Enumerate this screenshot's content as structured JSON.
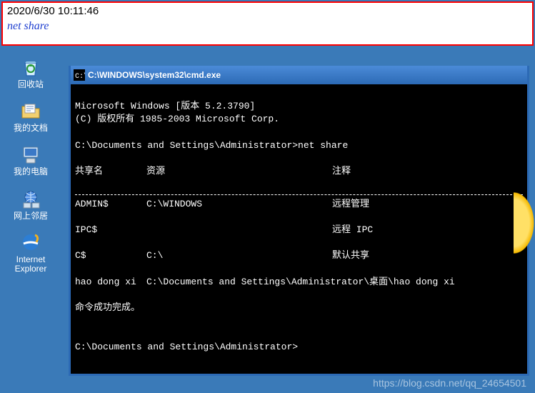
{
  "note": {
    "timestamp": "2020/6/30 10:11:46",
    "command": "net share"
  },
  "desktop": {
    "recycle": "回收站",
    "docs": "我的文档",
    "computer": "我的电脑",
    "network": "网上邻居",
    "ie": "Internet Explorer"
  },
  "cmd": {
    "title": "C:\\WINDOWS\\system32\\cmd.exe",
    "header1": "Microsoft Windows [版本 5.2.3790]",
    "header2": "(C) 版权所有 1985-2003 Microsoft Corp.",
    "prompt1": "C:\\Documents and Settings\\Administrator>net share",
    "col_share": "共享名",
    "col_res": "资源",
    "col_rem": "注释",
    "shares": [
      {
        "name": "ADMIN$",
        "res": "C:\\WINDOWS",
        "rem": "远程管理"
      },
      {
        "name": "IPC$",
        "res": "",
        "rem": "远程 IPC"
      },
      {
        "name": "C$",
        "res": "C:\\",
        "rem": "默认共享"
      },
      {
        "name": "hao dong xi",
        "res": "C:\\Documents and Settings\\Administrator\\桌面\\hao dong xi",
        "rem": ""
      }
    ],
    "success": "命令成功完成。",
    "prompt2": "C:\\Documents and Settings\\Administrator>"
  },
  "watermark": "https://blog.csdn.net/qq_24654501"
}
